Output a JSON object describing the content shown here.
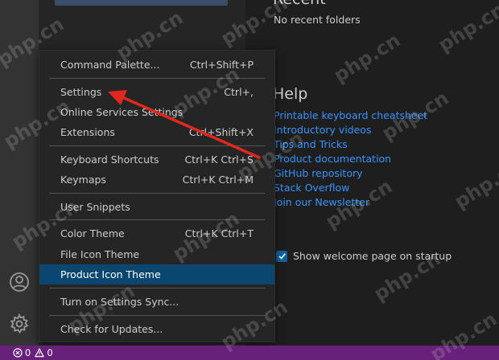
{
  "welcome": {
    "recent_heading": "Recent",
    "recent_empty": "No recent folders",
    "help_heading": "Help",
    "help_links": [
      "Printable keyboard cheatsheet",
      "Introductory videos",
      "Tips and Tricks",
      "Product documentation",
      "GitHub repository",
      "Stack Overflow",
      "Join our Newsletter"
    ],
    "show_welcome_label": "Show welcome page on startup",
    "show_welcome_checked": true
  },
  "menu": {
    "items": [
      {
        "label": "Command Palette...",
        "shortcut": "Ctrl+Shift+P"
      },
      {
        "label": "Settings",
        "shortcut": "Ctrl+,"
      },
      {
        "label": "Online Services Settings",
        "shortcut": ""
      },
      {
        "label": "Extensions",
        "shortcut": "Ctrl+Shift+X"
      },
      {
        "label": "Keyboard Shortcuts",
        "shortcut": "Ctrl+K Ctrl+S"
      },
      {
        "label": "Keymaps",
        "shortcut": "Ctrl+K Ctrl+M"
      },
      {
        "label": "User Snippets",
        "shortcut": ""
      },
      {
        "label": "Color Theme",
        "shortcut": "Ctrl+K Ctrl+T"
      },
      {
        "label": "File Icon Theme",
        "shortcut": ""
      },
      {
        "label": "Product Icon Theme",
        "shortcut": ""
      },
      {
        "label": "Turn on Settings Sync...",
        "shortcut": ""
      },
      {
        "label": "Check for Updates...",
        "shortcut": ""
      }
    ],
    "active_item": "Product Icon Theme"
  },
  "activity_bar": {
    "icons": [
      "account-icon",
      "manage-gear-icon"
    ]
  },
  "status_bar": {
    "errors": "0",
    "warnings": "0"
  },
  "watermark": {
    "text": "php.cn"
  },
  "colors": {
    "status_bar": "#68217a",
    "link": "#3794ff",
    "menu_active": "#094771",
    "annotation_arrow": "#e0281e"
  }
}
